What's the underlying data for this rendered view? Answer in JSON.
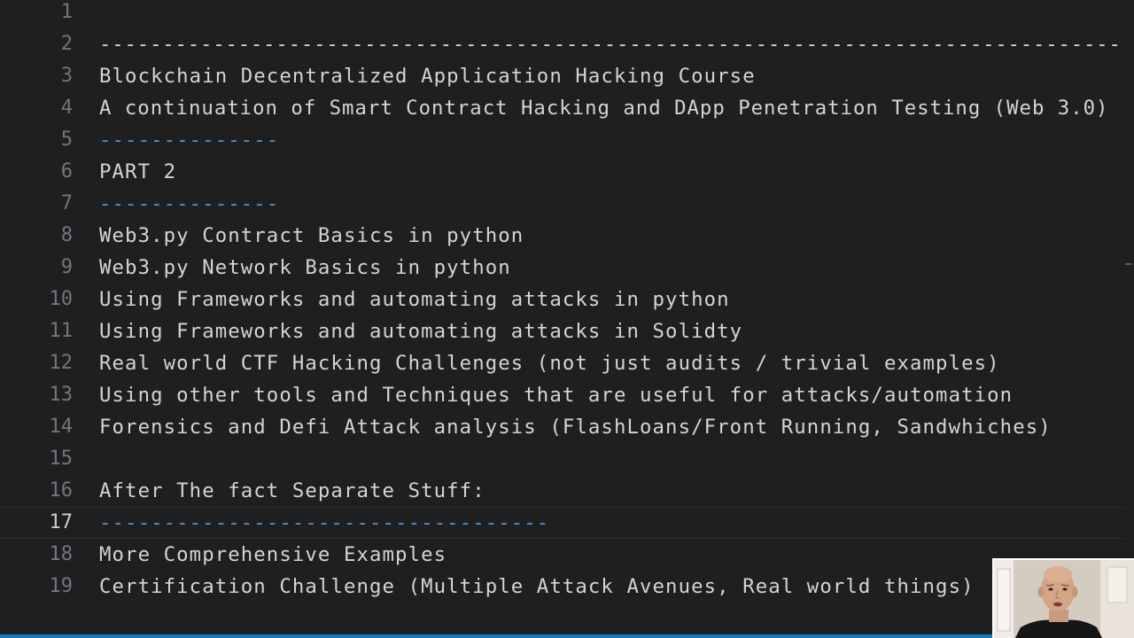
{
  "editor": {
    "current_line": "17",
    "lines": [
      {
        "number": "1",
        "text": ""
      },
      {
        "number": "2",
        "text": "---------------------------------------------------------------------------------"
      },
      {
        "number": "3",
        "text": "Blockchain Decentralized Application Hacking Course"
      },
      {
        "number": "4",
        "text": "A continuation of Smart Contract Hacking and DApp Penetration Testing (Web 3.0)"
      },
      {
        "number": "5",
        "text": "--------------"
      },
      {
        "number": "6",
        "text": "PART 2"
      },
      {
        "number": "7",
        "text": "--------------"
      },
      {
        "number": "8",
        "text": "Web3.py Contract Basics in python"
      },
      {
        "number": "9",
        "text": "Web3.py Network Basics in python"
      },
      {
        "number": "10",
        "text": "Using Frameworks and automating attacks in python"
      },
      {
        "number": "11",
        "text": "Using Frameworks and automating attacks in Solidty"
      },
      {
        "number": "12",
        "text": "Real world CTF Hacking Challenges (not just audits / trivial examples)"
      },
      {
        "number": "13",
        "text": "Using other tools and Techniques that are useful for attacks/automation"
      },
      {
        "number": "14",
        "text": "Forensics and Defi Attack analysis (FlashLoans/Front Running, Sandwhiches)"
      },
      {
        "number": "15",
        "text": ""
      },
      {
        "number": "16",
        "text": "After The fact Separate Stuff:"
      },
      {
        "number": "17",
        "text": "-----------------------------------"
      },
      {
        "number": "18",
        "text": "More Comprehensive Examples"
      },
      {
        "number": "19",
        "text": "Certification Challenge (Multiple Attack Avenues, Real world things)"
      }
    ]
  },
  "colors": {
    "background": "#1f1f1f",
    "text": "#d4d4d4",
    "line_number": "#6e7681",
    "markdown_rule": "#4e94ce",
    "statusbar": "#0e7dc7"
  },
  "webcam": {
    "icon": "presenter-webcam"
  }
}
